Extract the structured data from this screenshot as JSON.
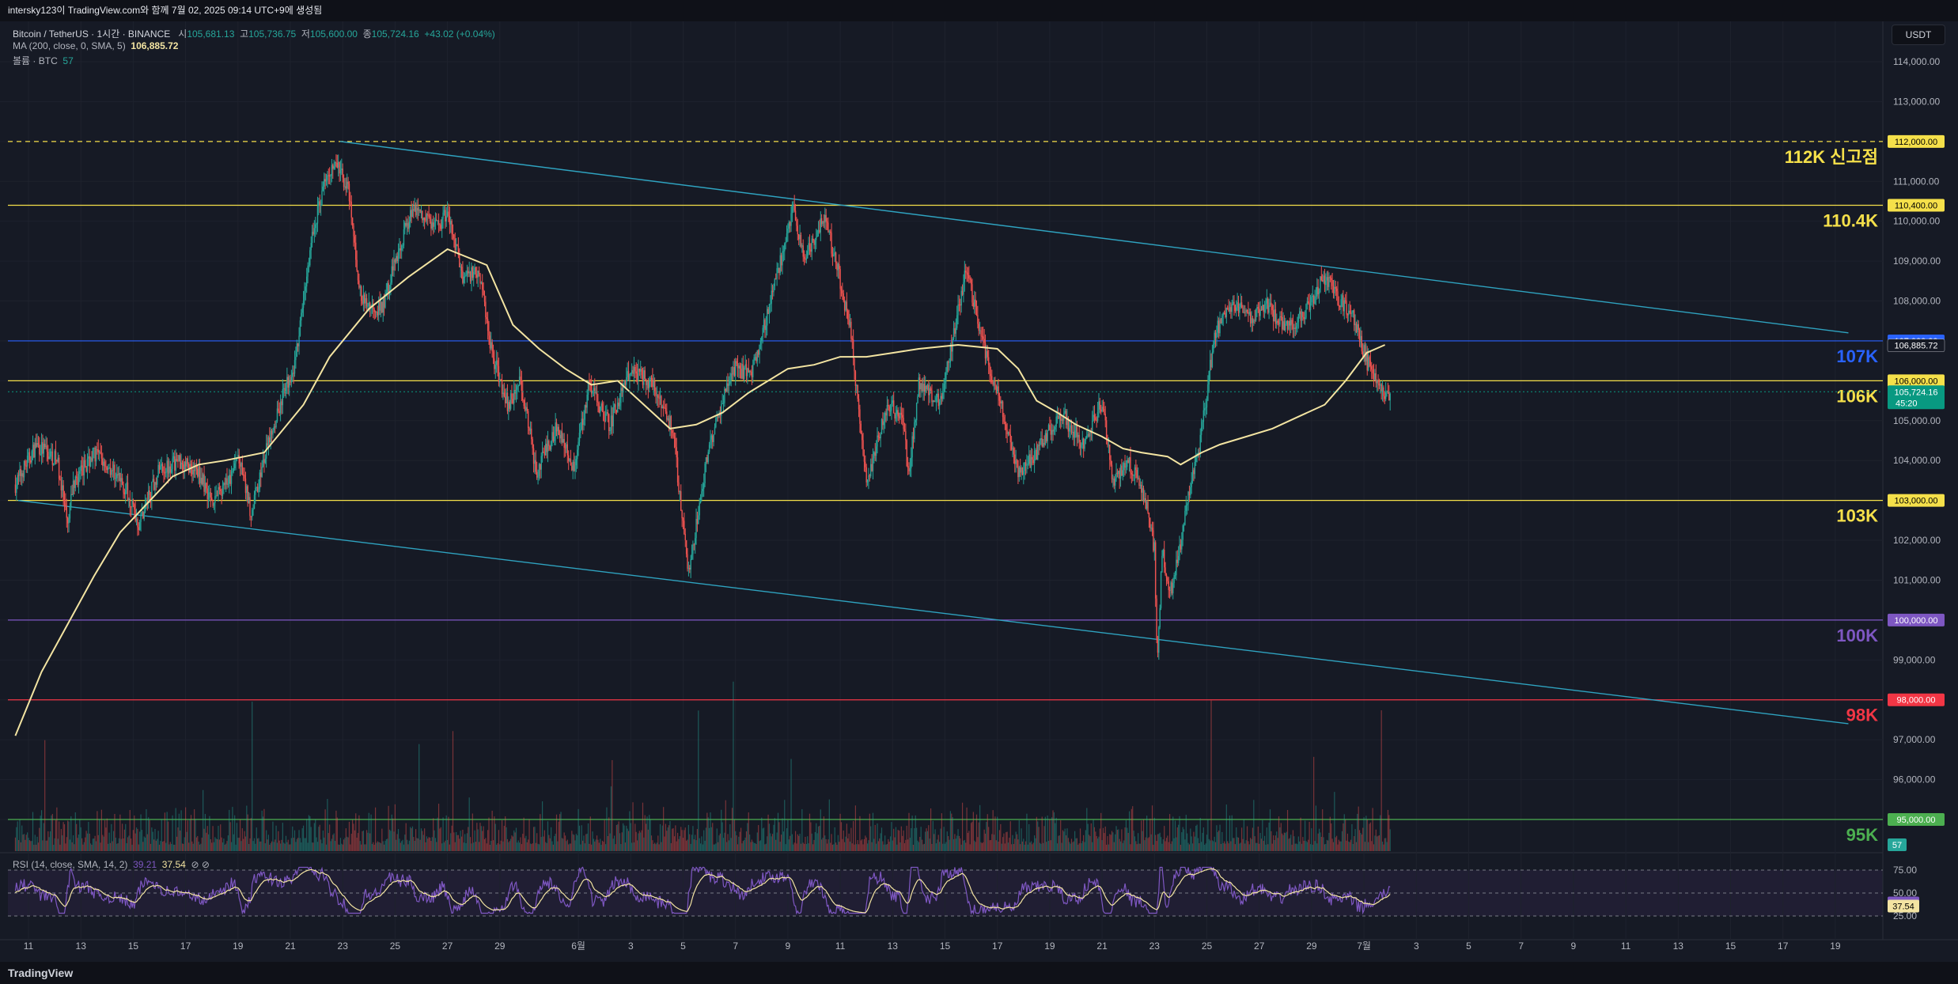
{
  "header": {
    "title": "intersky123이 TradingView.com와 함께 7월 02, 2025 09:14 UTC+9에 생성됨"
  },
  "legend": {
    "symbol": "Bitcoin / TetherUS · 1시간 · BINANCE",
    "o_label": "시",
    "o": "105,681.13",
    "h_label": "고",
    "h": "105,736.75",
    "l_label": "저",
    "l": "105,600.00",
    "c_label": "종",
    "c": "105,724.16",
    "chg": "+43.02 (+0.04%)",
    "ma_label": "MA (200, close, 0, SMA, 5)",
    "ma_value": "106,885.72",
    "vol_label": "볼륨 · BTC",
    "vol_value": "57"
  },
  "currency_button": "USDT",
  "rsi": {
    "label": "RSI (14, close, SMA, 14, 2)",
    "value": "39.21",
    "ma_value": "37.54",
    "icons": "⊘ ⊘"
  },
  "footer": {
    "brand": "TradingView"
  },
  "colors": {
    "background": "#161a25",
    "up": "#26a69a",
    "down": "#ef5350",
    "ma": "#f3e4a2",
    "channel": "#2fa3c0",
    "rsi": "#7e57c2"
  },
  "chart_data": {
    "type": "candlestick",
    "title": "Bitcoin / TetherUS · 1시간 · BINANCE",
    "ylim": [
      94000,
      114800
    ],
    "y_ticks": [
      95000,
      96000,
      97000,
      98000,
      99000,
      100000,
      101000,
      102000,
      103000,
      104000,
      105000,
      106000,
      107000,
      108000,
      109000,
      110000,
      111000,
      112000,
      113000,
      114000
    ],
    "y_tick_labels": [
      "95,000.00",
      "96,000.00",
      "97,000.00",
      "98,000.00",
      "99,000.00",
      "100,000.00",
      "101,000.00",
      "102,000.00",
      "103,000.00",
      "104,000.00",
      "105,000.00",
      "106,000.00",
      "107,000.00",
      "108,000.00",
      "109,000.00",
      "110,000.00",
      "111,000.00",
      "112,000.00",
      "113,000.00",
      "114,000.00"
    ],
    "x_axis": {
      "range_days": [
        10.5,
        55.5
      ],
      "ticks": [
        [
          11,
          "11"
        ],
        [
          13,
          "13"
        ],
        [
          15,
          "15"
        ],
        [
          17,
          "17"
        ],
        [
          19,
          "19"
        ],
        [
          21,
          "21"
        ],
        [
          23,
          "23"
        ],
        [
          25,
          "25"
        ],
        [
          27,
          "27"
        ],
        [
          29,
          "29"
        ],
        [
          32,
          "6월"
        ],
        [
          34,
          "3"
        ],
        [
          36,
          "5"
        ],
        [
          38,
          "7"
        ],
        [
          40,
          "9"
        ],
        [
          42,
          "11"
        ],
        [
          44,
          "13"
        ],
        [
          46,
          "15"
        ],
        [
          48,
          "17"
        ],
        [
          50,
          "19"
        ],
        [
          52,
          "21"
        ],
        [
          54,
          "23"
        ],
        [
          56,
          "25"
        ],
        [
          58,
          "27"
        ],
        [
          60,
          "29"
        ],
        [
          62,
          "7월"
        ],
        [
          64,
          "3"
        ],
        [
          66,
          "5"
        ],
        [
          68,
          "7"
        ],
        [
          70,
          "9"
        ],
        [
          72,
          "11"
        ],
        [
          74,
          "13"
        ],
        [
          76,
          "15"
        ],
        [
          78,
          "17"
        ],
        [
          80,
          "19"
        ]
      ]
    },
    "price_path_days": [
      10.5,
      11.3,
      12.1,
      12.5,
      12.7,
      13.5,
      14.3,
      14.8,
      15.2,
      16.0,
      16.8,
      17.5,
      18.0,
      18.7,
      19.0,
      19.5,
      20.3,
      20.6,
      21.2,
      21.8,
      22.4,
      22.8,
      23.2,
      23.7,
      24.5,
      25.0,
      25.7,
      26.6,
      27.0,
      27.6,
      28.2,
      28.7,
      29.3,
      29.8,
      30.4,
      31.2,
      31.8,
      32.4,
      33.2,
      34.0,
      34.9,
      35.6,
      36.2,
      36.9,
      37.6,
      38.0,
      38.6,
      39.2,
      40.2,
      40.6,
      41.4,
      42.0,
      42.4,
      43.0,
      43.8,
      44.4,
      44.6,
      45.0,
      45.8,
      46.8,
      47.5,
      48.2,
      48.8,
      49.5,
      50.4,
      51.3,
      52.0,
      52.4,
      53.0,
      53.6,
      54.0,
      54.1,
      54.3,
      54.6,
      54.9,
      55.3,
      55.8,
      56.3,
      57.0,
      57.6,
      58.3,
      59.0,
      59.6,
      60.5,
      61.1,
      61.6,
      62.1,
      62.6,
      63.0
    ],
    "price_path": [
      103400,
      104400,
      104000,
      102300,
      103400,
      104200,
      103700,
      103200,
      102400,
      103800,
      104000,
      103700,
      103000,
      103500,
      104100,
      102700,
      104800,
      105400,
      106500,
      109500,
      111300,
      111400,
      110800,
      108000,
      107800,
      109000,
      110400,
      109800,
      110200,
      108600,
      108800,
      106700,
      105400,
      106000,
      103700,
      104900,
      103800,
      105900,
      104900,
      106300,
      105900,
      104800,
      101200,
      104000,
      105800,
      106300,
      106200,
      107600,
      110300,
      109000,
      110100,
      108500,
      107200,
      103400,
      105400,
      105100,
      103500,
      106000,
      105400,
      108800,
      106800,
      105200,
      103700,
      104200,
      105200,
      104400,
      105500,
      103500,
      104000,
      103200,
      101800,
      98900,
      101700,
      100700,
      101500,
      103100,
      104700,
      107200,
      108000,
      107500,
      107900,
      107300,
      107600,
      108600,
      108000,
      107600,
      106500,
      105700,
      105720
    ],
    "ma200": {
      "value": 106885.72,
      "days": [
        10.5,
        11.5,
        12.5,
        13.5,
        14.5,
        15.5,
        16.5,
        17.5,
        18.5,
        20.0,
        21.5,
        22.5,
        24.0,
        25.5,
        27.0,
        28.5,
        29.5,
        30.5,
        31.5,
        32.5,
        33.5,
        34.5,
        35.5,
        36.5,
        37.5,
        38.5,
        40.0,
        41.0,
        42.0,
        43.0,
        44.0,
        45.0,
        46.5,
        48.0,
        48.8,
        49.5,
        50.3,
        51.0,
        52.0,
        52.8,
        53.5,
        54.5,
        55.0,
        55.8,
        56.5,
        57.5,
        58.5,
        59.5,
        60.5,
        61.3,
        62.1,
        62.8
      ],
      "values": [
        97100,
        98700,
        99900,
        101100,
        102200,
        102900,
        103600,
        103900,
        104000,
        104200,
        105400,
        106600,
        107800,
        108600,
        109300,
        108900,
        107400,
        106800,
        106300,
        105900,
        106000,
        105400,
        104800,
        104900,
        105200,
        105700,
        106300,
        106400,
        106600,
        106600,
        106700,
        106800,
        106900,
        106800,
        106300,
        105500,
        105200,
        104900,
        104600,
        104300,
        104200,
        104100,
        103900,
        104200,
        104400,
        104600,
        104800,
        105100,
        105400,
        106000,
        106700,
        106900
      ]
    },
    "horizontal_levels": [
      {
        "price": 112000,
        "text": "112K 신고점",
        "tag": "112,000.00",
        "color": "#f5e04a",
        "dashed": true
      },
      {
        "price": 110400,
        "text": "110.4K",
        "tag": "110,400.00",
        "color": "#f5e04a"
      },
      {
        "price": 107000,
        "text": "107K",
        "tag": "107,000.00",
        "color": "#2962ff"
      },
      {
        "price": 106000,
        "text": "106K",
        "tag": "106,000.00",
        "color": "#f5e04a"
      },
      {
        "price": 103000,
        "text": "103K",
        "tag": "103,000.00",
        "color": "#f5e04a"
      },
      {
        "price": 100000,
        "text": "100K",
        "tag": "100,000.00",
        "color": "#7e57c2"
      },
      {
        "price": 98000,
        "text": "98K",
        "tag": "98,000.00",
        "color": "#f23645"
      },
      {
        "price": 95000,
        "text": "95K",
        "tag": "95,000.00",
        "color": "#4caf50"
      }
    ],
    "channel_lines": [
      {
        "from": [
          22.9,
          112000
        ],
        "to": [
          80.5,
          107200
        ]
      },
      {
        "from": [
          10.6,
          103000
        ],
        "to": [
          80.5,
          97400
        ]
      }
    ],
    "price_tags": [
      {
        "label": "106,885.72",
        "price": 106885.72
      },
      {
        "label": "105,724.16",
        "sub": "45:20",
        "price": 105724.16
      }
    ],
    "volume": {
      "last": "57"
    },
    "rsi_axis": {
      "ticks": [
        75,
        50,
        25
      ],
      "tick_labels": [
        "75.00",
        "50.00",
        "25.00"
      ],
      "value": 39.21,
      "ma": 37.54
    }
  }
}
